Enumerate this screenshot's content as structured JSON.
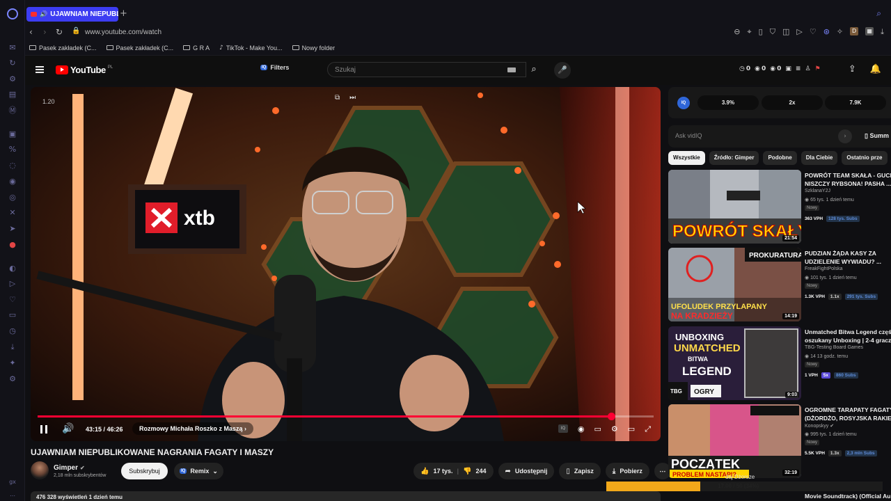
{
  "browser": {
    "tab_title": "UJAWNIAM NIEPUBLIK",
    "url": "www.youtube.com/watch",
    "bookmarks": [
      "Pasek zakładek (C...",
      "Pasek zakładek (C...",
      "G R A",
      "TikTok - Make You...",
      "Nowy folder"
    ],
    "sidebar_icons": [
      "opera-icon",
      "messenger-icon",
      "refresh-icon",
      "bot-icon",
      "flow-icon",
      "mail-icon",
      "twitch-icon",
      "percent-icon",
      "chat-icon",
      "discord-icon",
      "instagram-icon",
      "x-icon",
      "telegram-icon",
      "vk-icon",
      "spotify-icon",
      "player-icon",
      "heart-icon",
      "wallet-icon",
      "clock-icon",
      "download-icon",
      "extensions-icon",
      "settings-icon"
    ]
  },
  "youtube": {
    "logo_text": "YouTube",
    "logo_region": "PL",
    "filters_label": "Filters",
    "search_placeholder": "Szukaj",
    "header_stats": [
      "0",
      "0",
      "0"
    ]
  },
  "player": {
    "watermark_number": "1.20",
    "time": "43:15 / 46:26",
    "chapter": "Rozmowy Michała Roszko z Maszą",
    "progress": 0.931
  },
  "video": {
    "title": "UJAWNIAM NIEPUBLIKOWANE NAGRANIA FAGATY I MASZY",
    "channel": "Gimper",
    "subscribers": "2,18 mln subskrybentów",
    "subscribe_label": "Subskrybuj",
    "remix_label": "Remix",
    "likes": "17 tys.",
    "dislikes": "244",
    "share_label": "Udostępnij",
    "save_label": "Zapisz",
    "download_label": "Pobierz",
    "views_line": "476 328 wyświetleń  1 dzień temu"
  },
  "vidiq": {
    "stats": [
      "3.9%",
      "2x",
      "7.9K"
    ],
    "ask_placeholder": "Ask vidIQ",
    "summary_label": "Summ"
  },
  "chips": [
    "Wszystkie",
    "Źródło: Gimper",
    "Podobne",
    "Dla Ciebie",
    "Ostatnio prze"
  ],
  "recommended": [
    {
      "title1": "POWRÓT TEAM SKAŁA - GUCIO",
      "title2": "NISZCZY RYBSONA! PASHA ...",
      "channel": "SzklanaY2J",
      "meta": "65 tys.   1 dzień temu",
      "badge": "Nowy",
      "vph": "363 VPH",
      "multiplier": "",
      "subs": "128 tys. Subs",
      "duration": "21:54",
      "thumb_text": "POWRÓT SKAŁY"
    },
    {
      "title1": "PUDZIAN ŻĄDA KASY ZA",
      "title2": "UDZIELENIE WYWIADU? ...",
      "channel": "FreakFightPolska",
      "meta": "101 tys.   1 dzień temu",
      "badge": "Nowy",
      "vph": "1.3K VPH",
      "multiplier": "1.1x",
      "subs": "291 tys. Subs",
      "duration": "14:19",
      "thumb_text": "UFOLUDEK PRZYLAPANY NA KRADZIEŻY"
    },
    {
      "title1": "Unmatched Bitwa Legend część",
      "title2": "oszukany Unboxing | 2-4 graczy",
      "channel": "TBG-Testing Board Games",
      "meta": "14   13 godz. temu",
      "badge": "Nowy",
      "vph": "1 VPH",
      "multiplier": "5x",
      "subs": "860 Subs",
      "duration": "9:03",
      "thumb_text": "UNBOXING UNMATCHED BITWA LEGEND"
    },
    {
      "title1": "OGROMNE TARAPATY FAGATY",
      "title2": "(DŻORDŻO, ROSYJSKA RAKIETA",
      "channel": "Konopskyy",
      "meta": "995 tys.   1 dzień temu",
      "badge": "Nowy",
      "vph": "5.5K VPH",
      "multiplier": "1.3x",
      "subs": "2,3 mln Subs",
      "duration": "32:19",
      "thumb_text": "POCZĄTEK PROBLEM NASTAPI?"
    }
  ],
  "download": {
    "name": "daj Dżorsze",
    "progress_text": "17.00 / 50 (34%)",
    "progress": 0.34,
    "next_title": "Movie Soundtrack) (Official Au"
  }
}
